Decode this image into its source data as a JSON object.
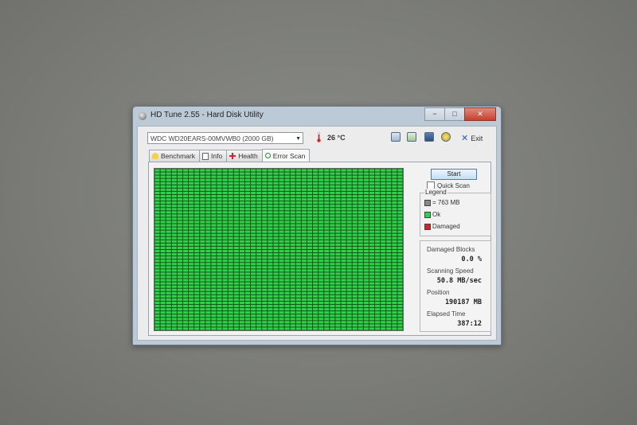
{
  "window": {
    "title": "HD Tune 2.55 - Hard Disk Utility",
    "controls": {
      "minimize": "−",
      "maximize": "□",
      "close": "✕"
    }
  },
  "toolbar": {
    "drive": "WDC WD20EARS-00MVWB0 (2000 GB)",
    "temperature": "26 °C",
    "exit_label": "Exit",
    "icons": [
      "copy-info-icon",
      "copy-screenshot-icon",
      "save-icon",
      "options-icon"
    ]
  },
  "tabs": [
    {
      "label": "Benchmark",
      "icon": "benchmark-icon"
    },
    {
      "label": "Info",
      "icon": "info-icon"
    },
    {
      "label": "Health",
      "icon": "health-icon"
    },
    {
      "label": "Error Scan",
      "icon": "magnifier-icon",
      "active": true
    }
  ],
  "error_scan": {
    "start_label": "Start",
    "quick_scan_label": "Quick Scan",
    "quick_scan_checked": false,
    "legend": {
      "title": "Legend",
      "items": [
        {
          "label": "= 763 MB",
          "color": "#8a8a8a"
        },
        {
          "label": "Ok",
          "color": "#2fd24a"
        },
        {
          "label": "Damaged",
          "color": "#d8202a"
        }
      ]
    },
    "stats": {
      "damaged_blocks_label": "Damaged Blocks",
      "damaged_blocks_value": "0.0 %",
      "scanning_speed_label": "Scanning Speed",
      "scanning_speed_value": "50.8 MB/sec",
      "position_label": "Position",
      "position_value": "190187 MB",
      "elapsed_time_label": "Elapsed Time",
      "elapsed_time_value": "387:12"
    },
    "block_grid": {
      "columns": 44,
      "rows": 50,
      "status": "ok",
      "ok_color": "#2fd24a",
      "grid_color": "#16551a"
    }
  }
}
